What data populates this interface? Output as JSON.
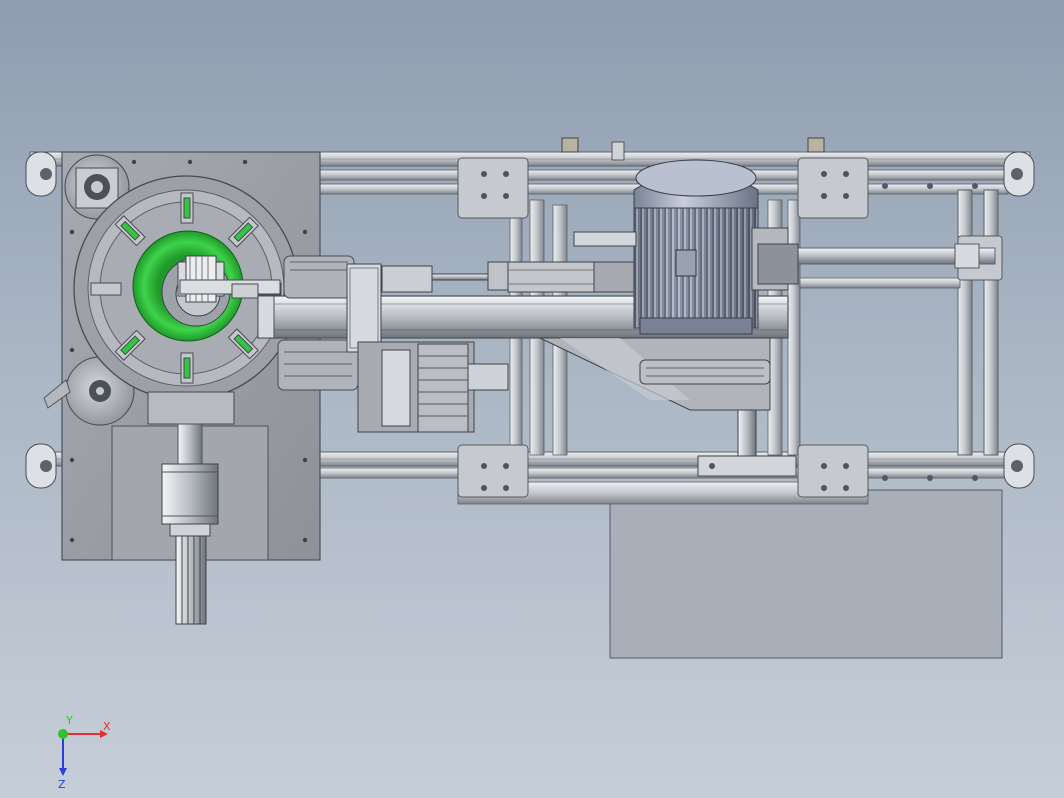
{
  "viewport": {
    "background_top": "#8e9db0",
    "background_bottom": "#c6ced8"
  },
  "colors": {
    "frame": "#c9ccd1",
    "frame_dark": "#6c7078",
    "plate": "#8c8f94",
    "motor": "#8d94a6",
    "accent_green": "#2fbf3a"
  },
  "triad": {
    "x_label": "X",
    "y_label": "Y",
    "z_label": "Z",
    "x_color": "#e03030",
    "y_color": "#30c030",
    "z_color": "#2b3fd8"
  }
}
